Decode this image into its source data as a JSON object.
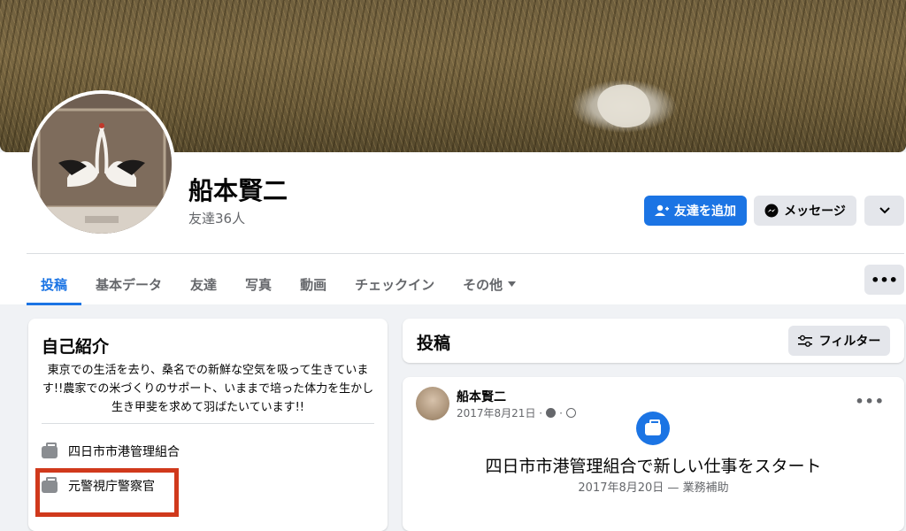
{
  "profile": {
    "name": "船本賢二",
    "friends_count": "友達36人"
  },
  "actions": {
    "add_friend": "友達を追加",
    "message": "メッセージ",
    "more_icon": "chevron-down-icon"
  },
  "tabs": [
    {
      "label": "投稿",
      "active": true
    },
    {
      "label": "基本データ"
    },
    {
      "label": "友達"
    },
    {
      "label": "写真"
    },
    {
      "label": "動画"
    },
    {
      "label": "チェックイン"
    },
    {
      "label": "その他"
    }
  ],
  "tabs_more": "•••",
  "intro": {
    "title": "自己紹介",
    "bio": "東京での生活を去り、桑名での新鮮な空気を吸って生きています!!農家での米づくりのサポート、いままで培った体力を生かし生き甲斐を求めて羽ばたいています!!",
    "work": [
      {
        "label": "四日市市港管理組合"
      },
      {
        "label": "元警視庁警察官"
      }
    ]
  },
  "posts_header": {
    "title": "投稿",
    "filter": "フィルター"
  },
  "post": {
    "author": "船本賢二",
    "date": "2017年8月21日 ·",
    "options": "•••",
    "job_title": "四日市市港管理組合で新しい仕事をスタート",
    "job_sub": "2017年8月20日 — 業務補助"
  },
  "colors": {
    "accent": "#1b74e4",
    "highlight": "#d0391c"
  }
}
